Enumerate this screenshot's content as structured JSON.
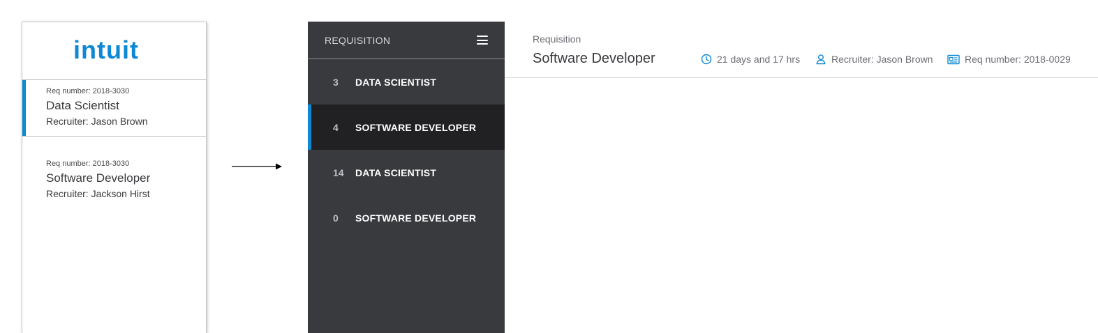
{
  "brand": {
    "logo_text": "intuit",
    "accent_color": "#0e88d3"
  },
  "left_list": {
    "cards": [
      {
        "req_label": "Req number: 2018-3030",
        "title": "Data Scientist",
        "recruiter": "Recruiter: Jason Brown",
        "selected": true
      },
      {
        "req_label": "Req number: 2018-3030",
        "title": "Software Developer",
        "recruiter": "Recruiter: Jackson Hirst",
        "selected": false
      }
    ]
  },
  "sidebar": {
    "header_label": "REQUISITION",
    "menu_icon": "hamburger-icon",
    "background_color": "#393a3d",
    "active_color": "#212123",
    "items": [
      {
        "count": "3",
        "label": "DATA SCIENTIST",
        "active": false
      },
      {
        "count": "4",
        "label": "SOFTWARE DEVELOPER",
        "active": true
      },
      {
        "count": "14",
        "label": "DATA SCIENTIST",
        "active": false
      },
      {
        "count": "0",
        "label": "SOFTWARE DEVELOPER",
        "active": false
      }
    ]
  },
  "detail": {
    "breadcrumb": "Requisition",
    "title": "Software Developer",
    "meta": {
      "time_icon": "clock-icon",
      "time_text": "21 days and 17 hrs",
      "recruiter_icon": "user-icon",
      "recruiter_text": "Recruiter: Jason Brown",
      "req_icon": "id-card-icon",
      "req_text": "Req number: 2018-0029"
    }
  }
}
